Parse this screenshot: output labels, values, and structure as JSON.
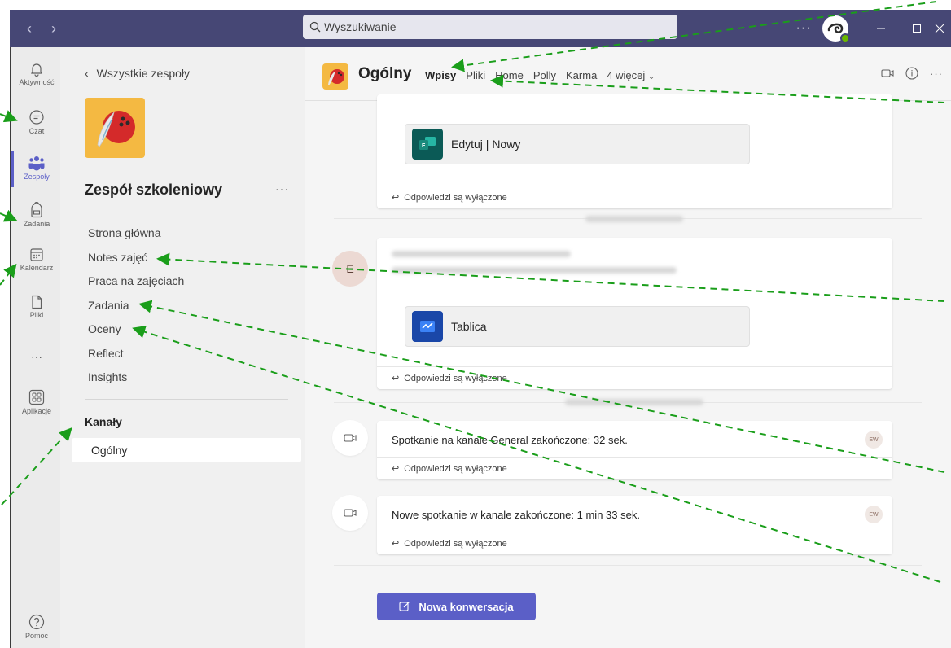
{
  "search": {
    "placeholder": "Wyszukiwanie"
  },
  "titlebar": {
    "more": "···"
  },
  "rail": {
    "items": [
      {
        "label": "Aktywność",
        "icon": "bell-icon"
      },
      {
        "label": "Czat",
        "icon": "chat-icon"
      },
      {
        "label": "Zespoły",
        "icon": "teams-icon"
      },
      {
        "label": "Zadania",
        "icon": "backpack-icon"
      },
      {
        "label": "Kalendarz",
        "icon": "calendar-icon"
      },
      {
        "label": "Pliki",
        "icon": "file-icon"
      },
      {
        "label": "···",
        "icon": "more-icon"
      },
      {
        "label": "Aplikacje",
        "icon": "apps-icon"
      },
      {
        "label": "Pomoc",
        "icon": "help-icon"
      }
    ],
    "active": "Zespoły"
  },
  "team": {
    "back": "Wszystkie zespoły",
    "name": "Zespół szkoleniowy",
    "more": "···",
    "menu": [
      "Strona główna",
      "Notes zajęć",
      "Praca na zajęciach",
      "Zadania",
      "Oceny",
      "Reflect",
      "Insights"
    ],
    "channels_heading": "Kanały",
    "channels": [
      "Ogólny"
    ]
  },
  "channel": {
    "name": "Ogólny",
    "tabs": [
      "Wpisy",
      "Pliki",
      "Home",
      "Polly",
      "Karma",
      "4 więcej"
    ],
    "active_tab": "Wpisy"
  },
  "feed": {
    "attachment1": "Edytuj | Nowy",
    "attachment2": "Tablica",
    "replies_off": "Odpowiedzi są wyłączone",
    "avatar_initial": "E",
    "meeting1": "Spotkanie na kanale General zakończone: 32 sek.",
    "meeting2": "Nowe spotkanie w kanale zakończone: 1 min 33 sek.",
    "badge": "EW",
    "new_conversation": "Nowa konwersacja"
  },
  "colors": {
    "accent": "#5b5fc7",
    "titlebar": "#464775",
    "annotation": "#1a9e1a"
  }
}
